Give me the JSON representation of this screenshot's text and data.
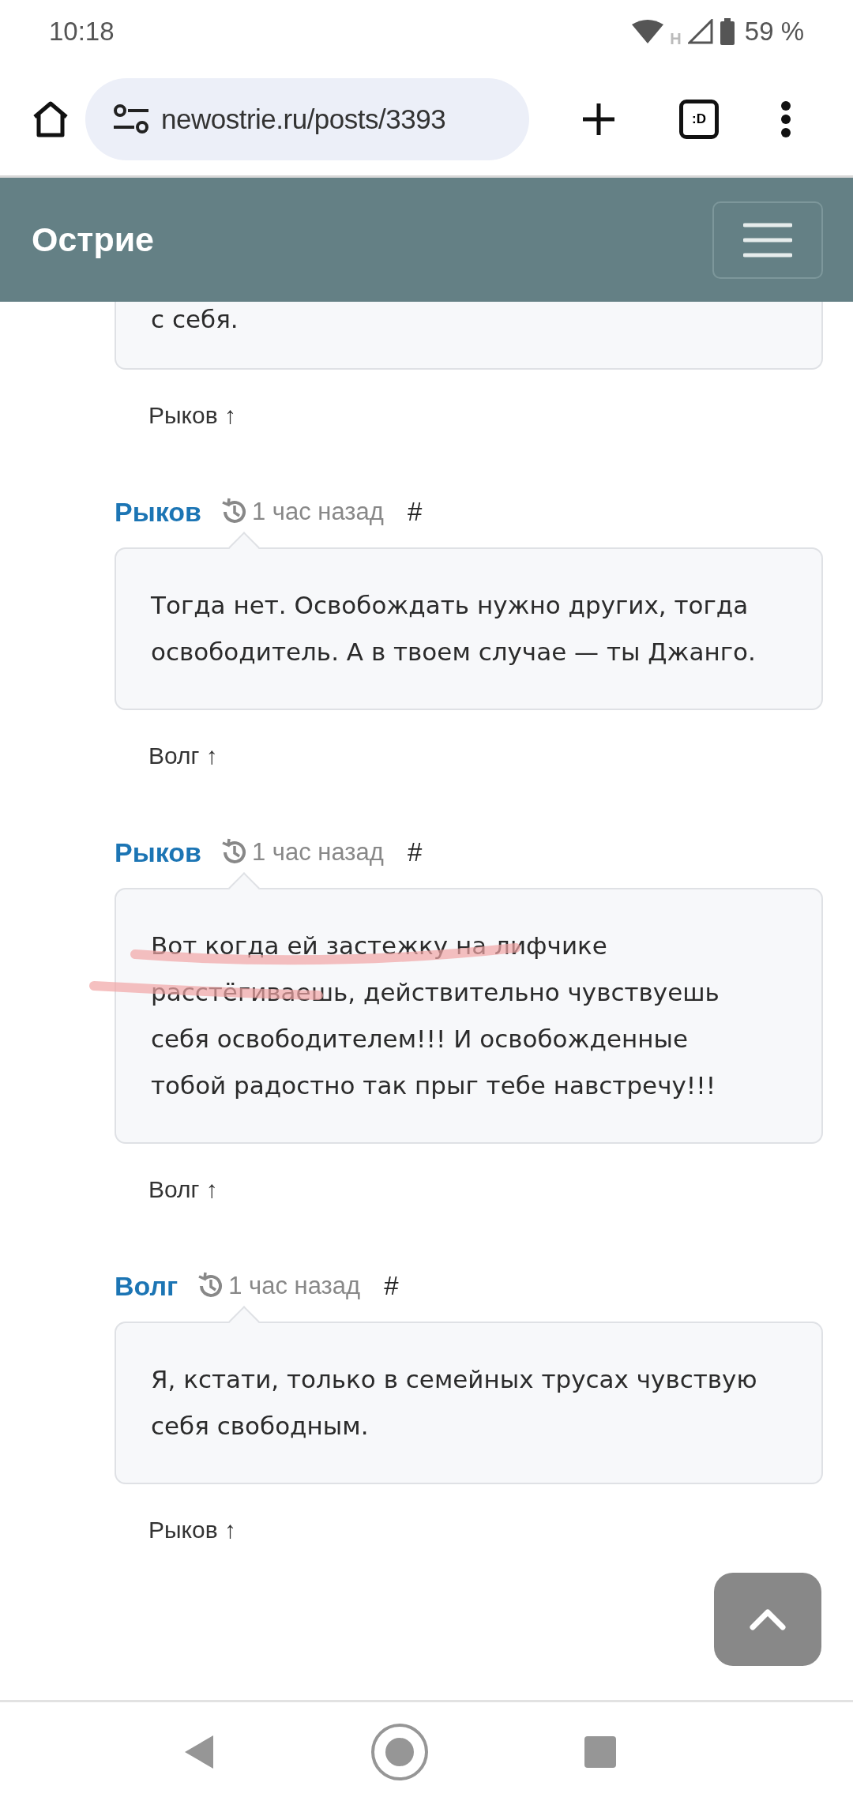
{
  "status_bar": {
    "time": "10:18",
    "network": "H",
    "battery": "59 %"
  },
  "browser": {
    "url": "newostrie.ru/posts/3393",
    "tab_badge": ":D"
  },
  "site": {
    "title": "Острие"
  },
  "partial_comment": {
    "text": "с себя.",
    "reply_link": "Рыков ↑"
  },
  "comments": [
    {
      "author": "Рыков",
      "time": "1 час назад",
      "anchor": "#",
      "text": "Тогда нет. Освобождать нужно других, тогда освободитель. А в твоем случае — ты Джанго.",
      "reply_link": "Волг ↑"
    },
    {
      "author": "Рыков",
      "time": "1 час назад",
      "anchor": "#",
      "text": "Вот когда ей застежку на лифчике расстёгиваешь, действительно чувствуешь себя освободителем!!! И освобожденные тобой радостно так прыг тебе навстречу!!!",
      "reply_link": "Волг ↑",
      "scribbled": true
    },
    {
      "author": "Волг",
      "time": "1 час назад",
      "anchor": "#",
      "text": "Я, кстати, только в семейных трусах чувствую себя свободным.",
      "reply_link": "Рыков ↑"
    }
  ]
}
